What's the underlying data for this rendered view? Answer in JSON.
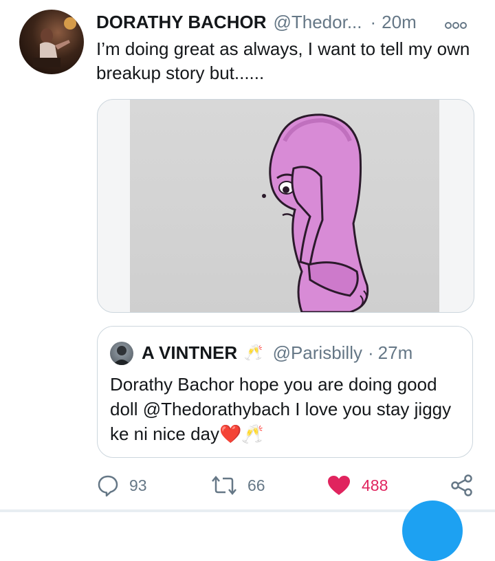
{
  "tweet": {
    "author_name": "DORATHY BACHOR",
    "handle": "@Thedor...",
    "separator": "·",
    "time": "20m",
    "text": "I’m doing great as always, I want to tell my own breakup story but......",
    "avatar_icon": "profile-photo",
    "more_icon": "more-options-icon"
  },
  "quoted_tweet": {
    "author_name": "A VINTNER",
    "emoji": "🥂",
    "handle": "@Parisbilly",
    "separator": "·",
    "time": "27m",
    "text": "Dorathy Bachor hope you are doing good doll @Thedorathybach I love you stay jiggy ke ni nice day",
    "trailing_heart": "❤️",
    "trailing_emoji": "🥂"
  },
  "actions": {
    "reply_count": "93",
    "retweet_count": "66",
    "like_count": "488",
    "share_icon": "share-icon"
  },
  "colors": {
    "text": "#14171a",
    "secondary": "#657786",
    "border": "#ccd6dd",
    "like": "#e0245e",
    "accent": "#1da1f2"
  }
}
